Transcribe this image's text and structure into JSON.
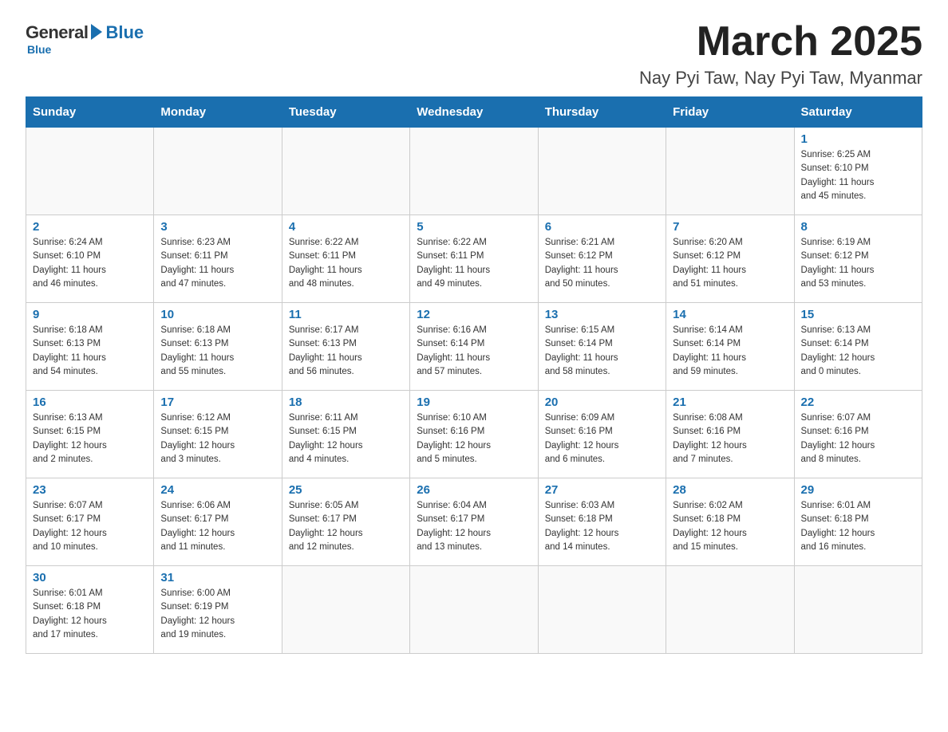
{
  "header": {
    "logo_general": "General",
    "logo_blue": "Blue",
    "month_year": "March 2025",
    "location": "Nay Pyi Taw, Nay Pyi Taw, Myanmar"
  },
  "weekdays": [
    "Sunday",
    "Monday",
    "Tuesday",
    "Wednesday",
    "Thursday",
    "Friday",
    "Saturday"
  ],
  "weeks": [
    [
      {
        "day": "",
        "info": ""
      },
      {
        "day": "",
        "info": ""
      },
      {
        "day": "",
        "info": ""
      },
      {
        "day": "",
        "info": ""
      },
      {
        "day": "",
        "info": ""
      },
      {
        "day": "",
        "info": ""
      },
      {
        "day": "1",
        "info": "Sunrise: 6:25 AM\nSunset: 6:10 PM\nDaylight: 11 hours\nand 45 minutes."
      }
    ],
    [
      {
        "day": "2",
        "info": "Sunrise: 6:24 AM\nSunset: 6:10 PM\nDaylight: 11 hours\nand 46 minutes."
      },
      {
        "day": "3",
        "info": "Sunrise: 6:23 AM\nSunset: 6:11 PM\nDaylight: 11 hours\nand 47 minutes."
      },
      {
        "day": "4",
        "info": "Sunrise: 6:22 AM\nSunset: 6:11 PM\nDaylight: 11 hours\nand 48 minutes."
      },
      {
        "day": "5",
        "info": "Sunrise: 6:22 AM\nSunset: 6:11 PM\nDaylight: 11 hours\nand 49 minutes."
      },
      {
        "day": "6",
        "info": "Sunrise: 6:21 AM\nSunset: 6:12 PM\nDaylight: 11 hours\nand 50 minutes."
      },
      {
        "day": "7",
        "info": "Sunrise: 6:20 AM\nSunset: 6:12 PM\nDaylight: 11 hours\nand 51 minutes."
      },
      {
        "day": "8",
        "info": "Sunrise: 6:19 AM\nSunset: 6:12 PM\nDaylight: 11 hours\nand 53 minutes."
      }
    ],
    [
      {
        "day": "9",
        "info": "Sunrise: 6:18 AM\nSunset: 6:13 PM\nDaylight: 11 hours\nand 54 minutes."
      },
      {
        "day": "10",
        "info": "Sunrise: 6:18 AM\nSunset: 6:13 PM\nDaylight: 11 hours\nand 55 minutes."
      },
      {
        "day": "11",
        "info": "Sunrise: 6:17 AM\nSunset: 6:13 PM\nDaylight: 11 hours\nand 56 minutes."
      },
      {
        "day": "12",
        "info": "Sunrise: 6:16 AM\nSunset: 6:14 PM\nDaylight: 11 hours\nand 57 minutes."
      },
      {
        "day": "13",
        "info": "Sunrise: 6:15 AM\nSunset: 6:14 PM\nDaylight: 11 hours\nand 58 minutes."
      },
      {
        "day": "14",
        "info": "Sunrise: 6:14 AM\nSunset: 6:14 PM\nDaylight: 11 hours\nand 59 minutes."
      },
      {
        "day": "15",
        "info": "Sunrise: 6:13 AM\nSunset: 6:14 PM\nDaylight: 12 hours\nand 0 minutes."
      }
    ],
    [
      {
        "day": "16",
        "info": "Sunrise: 6:13 AM\nSunset: 6:15 PM\nDaylight: 12 hours\nand 2 minutes."
      },
      {
        "day": "17",
        "info": "Sunrise: 6:12 AM\nSunset: 6:15 PM\nDaylight: 12 hours\nand 3 minutes."
      },
      {
        "day": "18",
        "info": "Sunrise: 6:11 AM\nSunset: 6:15 PM\nDaylight: 12 hours\nand 4 minutes."
      },
      {
        "day": "19",
        "info": "Sunrise: 6:10 AM\nSunset: 6:16 PM\nDaylight: 12 hours\nand 5 minutes."
      },
      {
        "day": "20",
        "info": "Sunrise: 6:09 AM\nSunset: 6:16 PM\nDaylight: 12 hours\nand 6 minutes."
      },
      {
        "day": "21",
        "info": "Sunrise: 6:08 AM\nSunset: 6:16 PM\nDaylight: 12 hours\nand 7 minutes."
      },
      {
        "day": "22",
        "info": "Sunrise: 6:07 AM\nSunset: 6:16 PM\nDaylight: 12 hours\nand 8 minutes."
      }
    ],
    [
      {
        "day": "23",
        "info": "Sunrise: 6:07 AM\nSunset: 6:17 PM\nDaylight: 12 hours\nand 10 minutes."
      },
      {
        "day": "24",
        "info": "Sunrise: 6:06 AM\nSunset: 6:17 PM\nDaylight: 12 hours\nand 11 minutes."
      },
      {
        "day": "25",
        "info": "Sunrise: 6:05 AM\nSunset: 6:17 PM\nDaylight: 12 hours\nand 12 minutes."
      },
      {
        "day": "26",
        "info": "Sunrise: 6:04 AM\nSunset: 6:17 PM\nDaylight: 12 hours\nand 13 minutes."
      },
      {
        "day": "27",
        "info": "Sunrise: 6:03 AM\nSunset: 6:18 PM\nDaylight: 12 hours\nand 14 minutes."
      },
      {
        "day": "28",
        "info": "Sunrise: 6:02 AM\nSunset: 6:18 PM\nDaylight: 12 hours\nand 15 minutes."
      },
      {
        "day": "29",
        "info": "Sunrise: 6:01 AM\nSunset: 6:18 PM\nDaylight: 12 hours\nand 16 minutes."
      }
    ],
    [
      {
        "day": "30",
        "info": "Sunrise: 6:01 AM\nSunset: 6:18 PM\nDaylight: 12 hours\nand 17 minutes."
      },
      {
        "day": "31",
        "info": "Sunrise: 6:00 AM\nSunset: 6:19 PM\nDaylight: 12 hours\nand 19 minutes."
      },
      {
        "day": "",
        "info": ""
      },
      {
        "day": "",
        "info": ""
      },
      {
        "day": "",
        "info": ""
      },
      {
        "day": "",
        "info": ""
      },
      {
        "day": "",
        "info": ""
      }
    ]
  ]
}
